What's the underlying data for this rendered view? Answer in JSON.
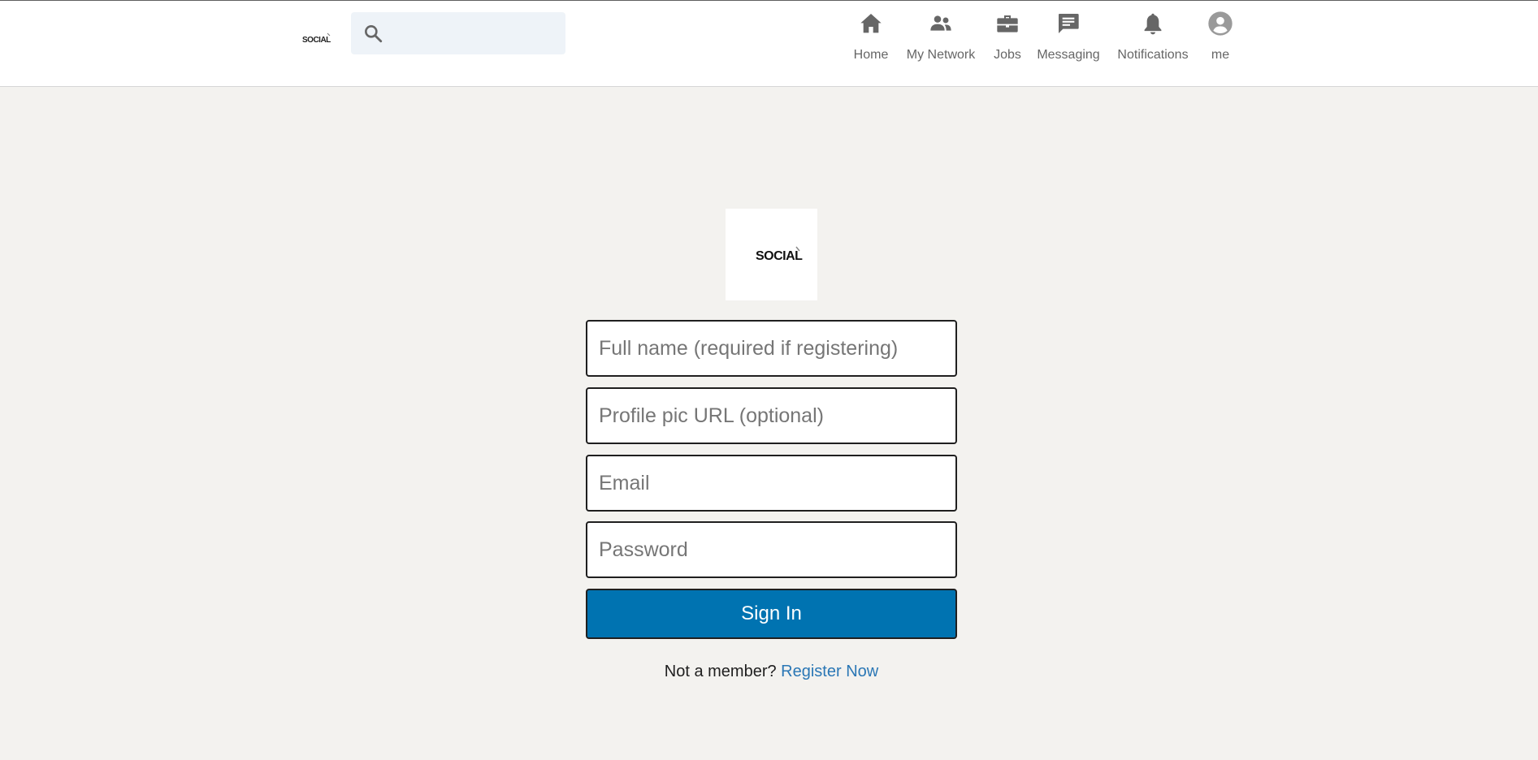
{
  "brand": {
    "logo_text": "SOCIAL"
  },
  "search": {
    "placeholder": ""
  },
  "nav": {
    "items": [
      {
        "label": "Home",
        "icon": "home-icon"
      },
      {
        "label": "My Network",
        "icon": "people-icon"
      },
      {
        "label": "Jobs",
        "icon": "briefcase-icon"
      },
      {
        "label": "Messaging",
        "icon": "message-icon"
      },
      {
        "label": "Notifications",
        "icon": "bell-icon"
      },
      {
        "label": "me",
        "icon": "avatar-icon"
      }
    ]
  },
  "form": {
    "full_name_placeholder": "Full name (required if registering)",
    "profile_pic_placeholder": "Profile pic URL (optional)",
    "email_placeholder": "Email",
    "password_placeholder": "Password",
    "submit_label": "Sign In",
    "register_prompt": "Not a member?",
    "register_link": "Register Now"
  },
  "colors": {
    "primary_button": "#0073b1",
    "link": "#2a77b5",
    "page_background": "#f3f2ef",
    "search_background": "#eef3f8",
    "nav_icon": "#666666"
  }
}
